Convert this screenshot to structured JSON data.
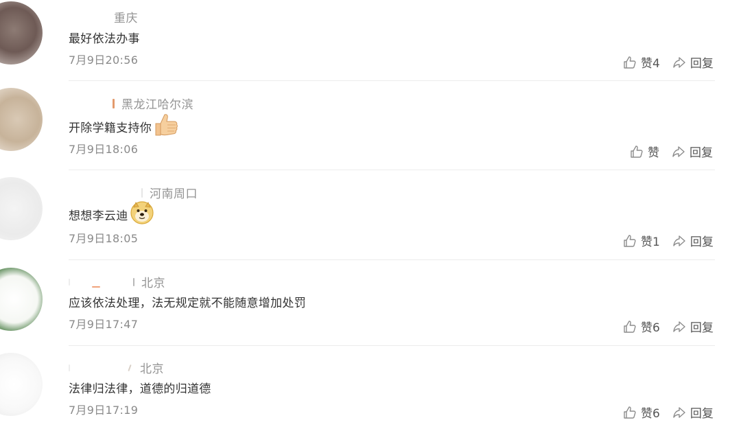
{
  "comments": [
    {
      "location": "重庆",
      "text": "最好依法办事",
      "time": "7月9日20:56",
      "like_label": "赞4",
      "reply_label": "回复"
    },
    {
      "location": "黑龙江哈尔滨",
      "text": "开除学籍支持你",
      "emoji": "thumbs-up-icon",
      "time": "7月9日18:06",
      "like_label": "赞",
      "reply_label": "回复"
    },
    {
      "location": "河南周口",
      "text": "想想李云迪",
      "emoji": "doge-icon",
      "time": "7月9日18:05",
      "like_label": "赞1",
      "reply_label": "回复"
    },
    {
      "location": "北京",
      "text": "应该依法处理，法无规定就不能随意增加处罚",
      "time": "7月9日17:47",
      "like_label": "赞6",
      "reply_label": "回复"
    },
    {
      "location": "北京",
      "text": "法律归法律，道德的归道德",
      "time": "7月9日17:19",
      "like_label": "赞6",
      "reply_label": "回复"
    }
  ],
  "colors": {
    "text": "#333333",
    "meta": "#939393",
    "time": "#8a8a8a",
    "divider": "#ececec",
    "icon": "#8c8c8c"
  }
}
